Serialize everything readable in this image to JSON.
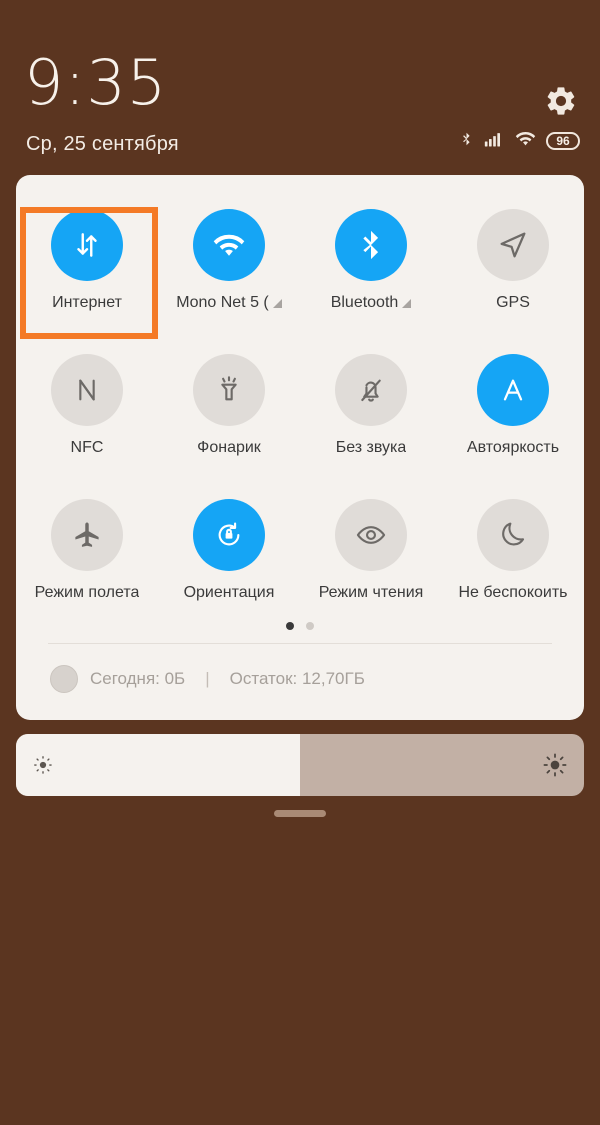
{
  "colors": {
    "background": "#5b3520",
    "panel": "#f5f2ee",
    "accent_on": "#15a5f5",
    "highlight": "#f47a26",
    "tile_off": "#e0dcd8",
    "text_dark": "#3b3b3b",
    "text_muted": "#a6a09a",
    "slider_track": "#c2b0a5"
  },
  "header": {
    "time": "9:35",
    "date": "Ср, 25 сентября",
    "settings_icon": "gear-icon",
    "status_icons": [
      "bluetooth-icon",
      "signal-bars-icon",
      "wifi-icon"
    ],
    "battery_level": "96"
  },
  "quick_settings": {
    "rows": [
      [
        {
          "label": "Интернет",
          "icon": "data-transfer-icon",
          "active": true,
          "highlighted": true,
          "expandable": false
        },
        {
          "label": "Mono Net 5 (",
          "icon": "wifi-icon",
          "active": true,
          "highlighted": false,
          "expandable": true
        },
        {
          "label": "Bluetooth",
          "icon": "bluetooth-icon",
          "active": true,
          "highlighted": false,
          "expandable": true
        },
        {
          "label": "GPS",
          "icon": "location-arrow-icon",
          "active": false,
          "highlighted": false,
          "expandable": false
        }
      ],
      [
        {
          "label": "NFC",
          "icon": "nfc-icon",
          "active": false,
          "highlighted": false,
          "expandable": false
        },
        {
          "label": "Фонарик",
          "icon": "flashlight-icon",
          "active": false,
          "highlighted": false,
          "expandable": false
        },
        {
          "label": "Без звука",
          "icon": "bell-muted-icon",
          "active": false,
          "highlighted": false,
          "expandable": false
        },
        {
          "label": "Автояркость",
          "icon": "auto-brightness-icon",
          "active": true,
          "highlighted": false,
          "expandable": false
        }
      ],
      [
        {
          "label": "Режим полета",
          "icon": "airplane-icon",
          "active": false,
          "highlighted": false,
          "expandable": false
        },
        {
          "label": "Ориентация",
          "icon": "rotation-lock-icon",
          "active": true,
          "highlighted": false,
          "expandable": false
        },
        {
          "label": "Режим чтения",
          "icon": "eye-icon",
          "active": false,
          "highlighted": false,
          "expandable": false
        },
        {
          "label": "Не беспокоить",
          "icon": "moon-icon",
          "active": false,
          "highlighted": false,
          "expandable": false
        }
      ]
    ],
    "page_dots": {
      "count": 2,
      "active_index": 0
    },
    "data_usage": {
      "today_label": "Сегодня: 0Б",
      "separator": "|",
      "remaining_label": "Остаток: 12,70ГБ"
    }
  },
  "brightness": {
    "value_percent": 50,
    "low_icon": "brightness-low-icon",
    "high_icon": "brightness-high-icon"
  },
  "handle": {
    "name": "drag-handle"
  }
}
